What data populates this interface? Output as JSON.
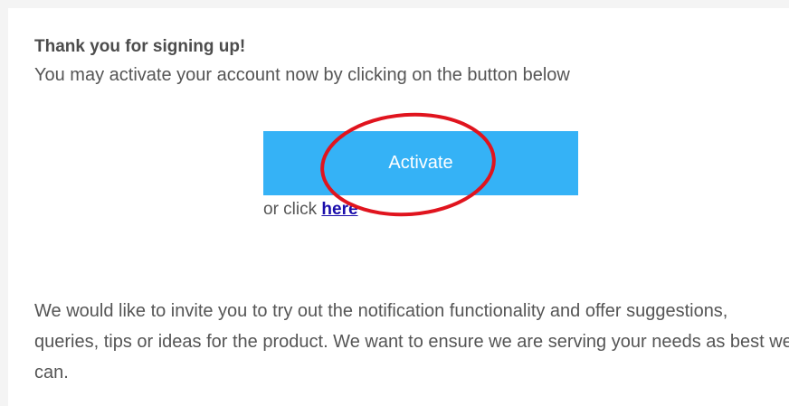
{
  "email": {
    "greeting": "Thank you for signing up!",
    "instruction": "You may activate your account now by clicking on the button below",
    "activate_button_label": "Activate",
    "alt_link_prefix": "or click",
    "alt_link_text": "here",
    "invite_text": "We would like to invite you to try out the notification functionality and offer suggestions, queries, tips or ideas for the product. We want to ensure we are serving your needs as best we can."
  },
  "colors": {
    "button_background": "#35b2f6",
    "annotation_circle": "#e0141e",
    "link": "#1a0dab"
  },
  "annotation": {
    "shape": "circle-highlight",
    "target": "activate-button"
  }
}
